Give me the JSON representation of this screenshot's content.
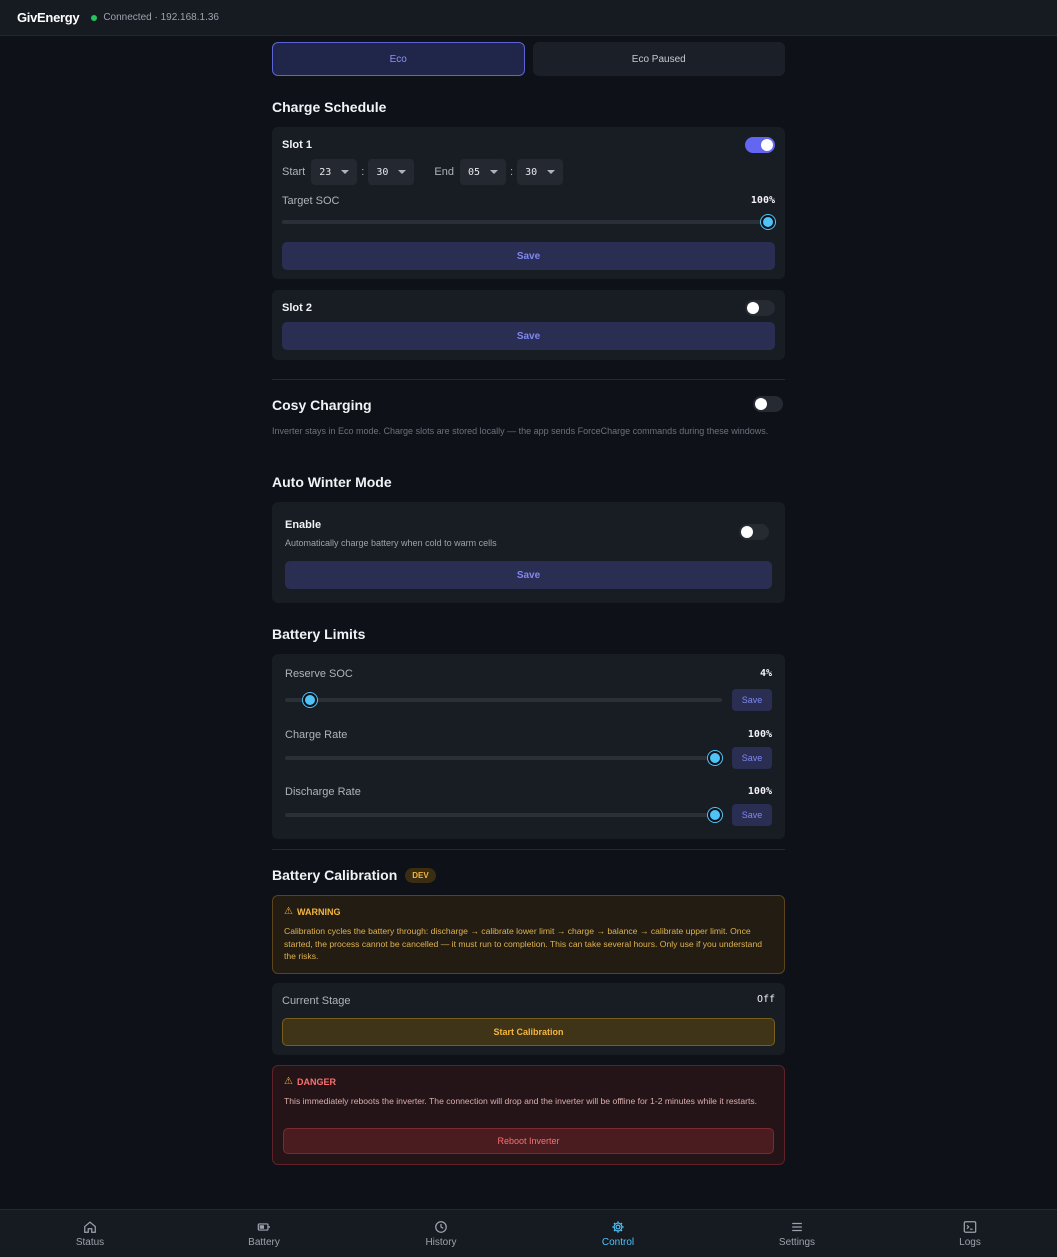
{
  "header": {
    "brand": "GivEnergy",
    "connection": "Connected · 192.168.1.36"
  },
  "modes": [
    {
      "label": "Eco",
      "active": true
    },
    {
      "label": "Eco Paused",
      "active": false
    }
  ],
  "charge_schedule": {
    "title": "Charge Schedule",
    "slot1": {
      "title": "Slot 1",
      "enabled": true,
      "start_label": "Start",
      "start_hour": "23",
      "start_min": "30",
      "end_label": "End",
      "end_hour": "05",
      "end_min": "30",
      "colon": ":",
      "target_label": "Target SOC",
      "target_value": "100%",
      "target_fraction": 1.0,
      "save_label": "Save"
    },
    "slot2": {
      "title": "Slot 2",
      "enabled": false,
      "save_label": "Save"
    }
  },
  "cosy": {
    "title": "Cosy Charging",
    "enabled": false,
    "description": "Inverter stays in Eco mode. Charge slots are stored locally — the app sends ForceCharge commands during these windows."
  },
  "winter": {
    "title": "Auto Winter Mode",
    "enable_label": "Enable",
    "enable_desc": "Automatically charge battery when cold to warm cells",
    "enabled": false,
    "save_label": "Save"
  },
  "limits": {
    "title": "Battery Limits",
    "reserve": {
      "label": "Reserve SOC",
      "value": "4%",
      "fraction": 0.04,
      "save_label": "Save"
    },
    "charge": {
      "label": "Charge Rate",
      "value": "100%",
      "fraction": 1.0,
      "save_label": "Save"
    },
    "discharge": {
      "label": "Discharge Rate",
      "value": "100%",
      "fraction": 1.0,
      "save_label": "Save"
    }
  },
  "calibration": {
    "title": "Battery Calibration",
    "badge": "DEV",
    "warning_title": "WARNING",
    "warning_text": "Calibration cycles the battery through: discharge → calibrate lower limit → charge → balance → calibrate upper limit. Once started, the process cannot be cancelled — it must run to completion. This can take several hours. Only use if you understand the risks.",
    "stage_label": "Current Stage",
    "stage_value": "Off",
    "start_label": "Start Calibration",
    "danger_title": "DANGER",
    "danger_text": "This immediately reboots the inverter. The connection will drop and the inverter will be offline for 1-2 minutes while it restarts.",
    "reboot_label": "Reboot Inverter"
  },
  "nav": [
    {
      "label": "Status",
      "icon": "home-icon",
      "active": false
    },
    {
      "label": "Battery",
      "icon": "battery-icon",
      "active": false
    },
    {
      "label": "History",
      "icon": "clock-icon",
      "active": false
    },
    {
      "label": "Control",
      "icon": "gear-icon",
      "active": true
    },
    {
      "label": "Settings",
      "icon": "menu-icon",
      "active": false
    },
    {
      "label": "Logs",
      "icon": "terminal-icon",
      "active": false
    }
  ],
  "colors": {
    "accent": "#6366f1",
    "slider": "#4fc3f7",
    "warning": "#f5b53d",
    "danger": "#f87171",
    "connected": "#22c55e"
  }
}
